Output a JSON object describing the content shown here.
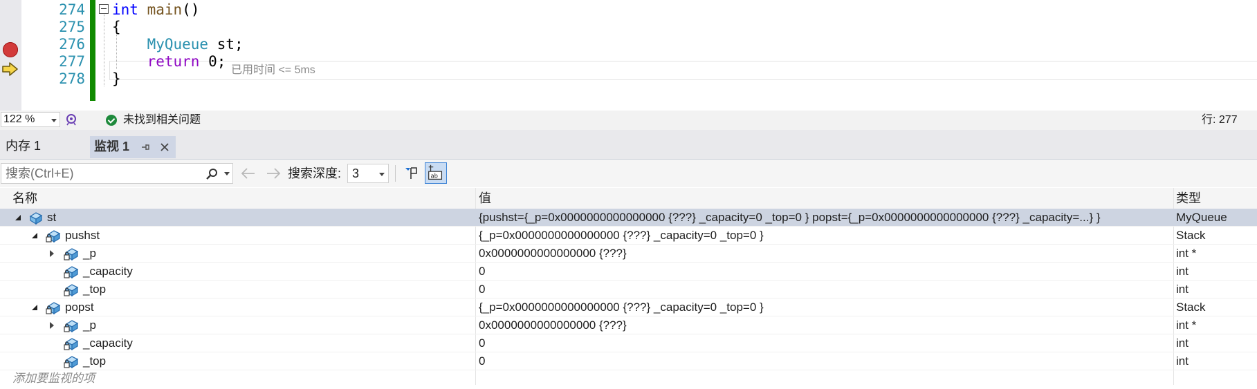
{
  "editor": {
    "line_numbers": [
      "274",
      "275",
      "276",
      "277",
      "278"
    ],
    "lines": [
      {
        "parts": [
          {
            "t": "int",
            "c": "kw"
          },
          {
            "t": " ",
            "c": "pu"
          },
          {
            "t": "main",
            "c": "fn"
          },
          {
            "t": "()",
            "c": "pu"
          }
        ]
      },
      {
        "parts": [
          {
            "t": "{",
            "c": "pu"
          }
        ]
      },
      {
        "parts": [
          {
            "t": "    ",
            "c": "pu"
          },
          {
            "t": "MyQueue",
            "c": "ty"
          },
          {
            "t": " st;",
            "c": "pu"
          }
        ]
      },
      {
        "parts": [
          {
            "t": "    ",
            "c": "pu"
          },
          {
            "t": "return",
            "c": "kw2"
          },
          {
            "t": " 0;",
            "c": "pu"
          }
        ]
      },
      {
        "parts": [
          {
            "t": "}",
            "c": "pu"
          }
        ]
      }
    ],
    "elapsed_hint": "已用时间 <= 5ms",
    "breakpoint_line": "276",
    "current_line": "277"
  },
  "statusbar": {
    "zoom": "122 %",
    "message": "未找到相关问题",
    "line_indicator": "行: 277"
  },
  "tabs": {
    "memory_label": "内存 1",
    "watch_label": "监视 1"
  },
  "watch_toolbar": {
    "search_placeholder": "搜索(Ctrl+E)",
    "depth_label": "搜索深度:",
    "depth_value": "3"
  },
  "grid": {
    "headers": {
      "name": "名称",
      "value": "值",
      "type": "类型"
    },
    "rows": [
      {
        "name": "st",
        "value": "{pushst={_p=0x0000000000000000 {???} _capacity=0 _top=0 } popst={_p=0x0000000000000000 {???} _capacity=...} }",
        "type": "MyQueue"
      },
      {
        "name": "pushst",
        "value": "{_p=0x0000000000000000 {???} _capacity=0 _top=0 }",
        "type": "Stack"
      },
      {
        "name": "_p",
        "value": "0x0000000000000000 {???}",
        "type": "int *"
      },
      {
        "name": "_capacity",
        "value": "0",
        "type": "int"
      },
      {
        "name": "_top",
        "value": "0",
        "type": "int"
      },
      {
        "name": "popst",
        "value": "{_p=0x0000000000000000 {???} _capacity=0 _top=0 }",
        "type": "Stack"
      },
      {
        "name": "_p",
        "value": "0x0000000000000000 {???}",
        "type": "int *"
      },
      {
        "name": "_capacity",
        "value": "0",
        "type": "int"
      },
      {
        "name": "_top",
        "value": "0",
        "type": "int"
      }
    ],
    "add_item_hint": "添加要监视的项"
  },
  "icons": {
    "breakpoint": "breakpoint-icon",
    "exec_arrow": "current-statement-arrow-icon",
    "object": "watch-object-icon",
    "search": "search-icon",
    "back": "back-arrow-icon",
    "forward": "forward-arrow-icon",
    "pin": "pin-icon",
    "close": "close-icon",
    "filter": "filter-icon",
    "hex": "hex-display-icon",
    "ok": "check-circle-icon",
    "intellicode": "intellicode-icon"
  },
  "colors": {
    "change_bar": "#108a00",
    "breakpoint": "#d23a3a",
    "selected_row": "#cdd4e1",
    "active_tab": "#cfd6e5",
    "keyword": "#0000ff",
    "type": "#2b91af",
    "control_keyword": "#8f08c4"
  }
}
